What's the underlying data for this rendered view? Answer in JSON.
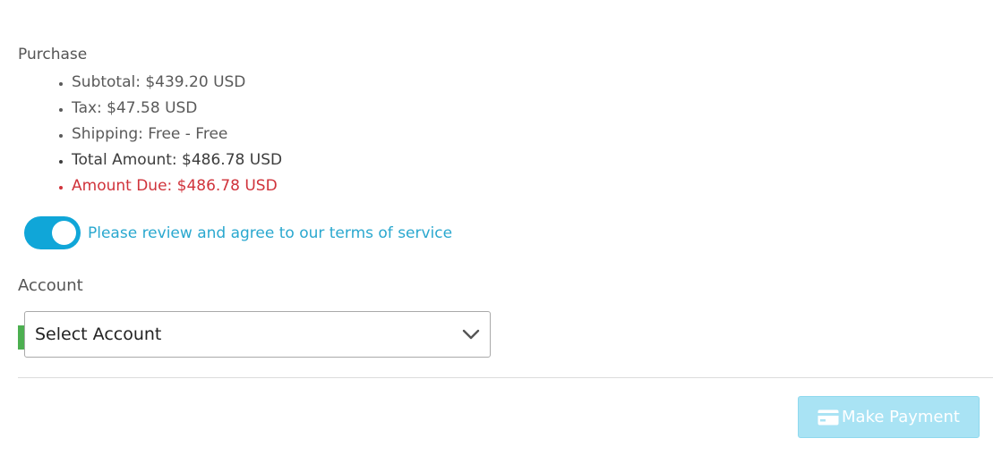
{
  "purchase": {
    "title": "Purchase",
    "items": [
      {
        "text": "Subtotal: $439.20 USD"
      },
      {
        "text": "Tax: $47.58 USD"
      },
      {
        "text": "Shipping: Free - Free"
      },
      {
        "text": "Total Amount: $486.78 USD"
      },
      {
        "text": "Amount Due: $486.78 USD"
      }
    ]
  },
  "terms": {
    "toggle_on": true,
    "label": "Please review and agree to our terms of service"
  },
  "account": {
    "label": "Account",
    "select_value": "Select Account"
  },
  "actions": {
    "make_payment_label": "Make Payment"
  },
  "colors": {
    "accent": "#10a6d8",
    "due": "#d0333b",
    "button_disabled": "#a9e3f4",
    "marker": "#4caf50"
  },
  "icons": {
    "toggle": "toggle-switch-icon",
    "select": "chevron-down-icon",
    "payment": "credit-card-icon"
  }
}
